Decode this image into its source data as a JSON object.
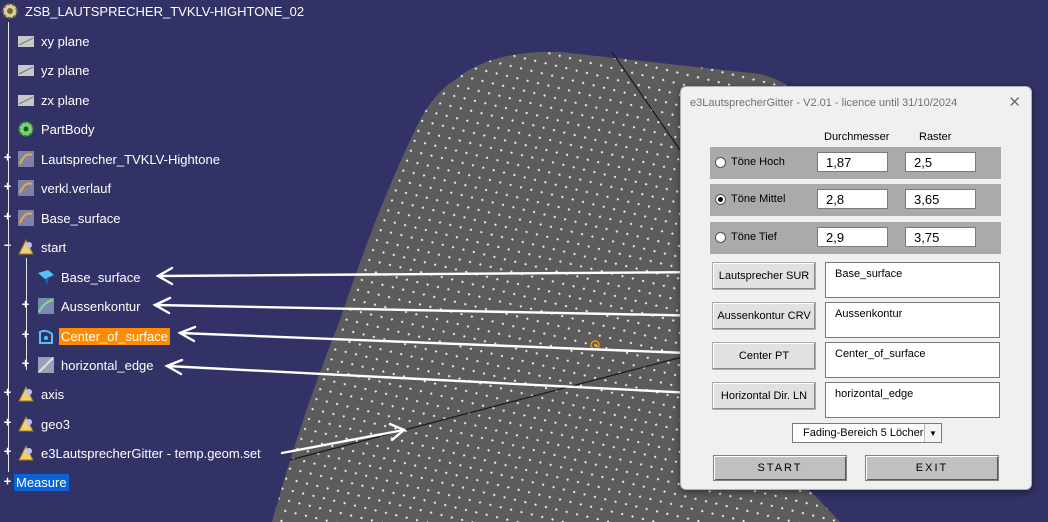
{
  "tree": {
    "root": "ZSB_LAUTSPRECHER_TVKLV-HIGHTONE_02",
    "nodes": [
      {
        "label": "xy plane"
      },
      {
        "label": "yz plane"
      },
      {
        "label": "zx plane"
      },
      {
        "label": "PartBody"
      },
      {
        "label": "Lautsprecher_TVKLV-Hightone"
      },
      {
        "label": "verkl.verlauf"
      },
      {
        "label": "Base_surface"
      },
      {
        "label": "start"
      },
      {
        "label": "Base_surface"
      },
      {
        "label": "Aussenkontur"
      },
      {
        "label": "Center_of_surface"
      },
      {
        "label": "horizontal_edge"
      },
      {
        "label": "axis"
      },
      {
        "label": "geo3"
      },
      {
        "label": "e3LautsprecherGitter - temp.geom.set"
      },
      {
        "label": "Measure"
      }
    ]
  },
  "dialog": {
    "title": "e3LautsprecherGitter - V2.01 - licence until 31/10/2024",
    "close_glyph": "✕",
    "col_durchmesser": "Durchmesser",
    "col_raster": "Raster",
    "rows": [
      {
        "label": "Töne Hoch",
        "durchmesser": "1,87",
        "raster": "2,5",
        "selected": false
      },
      {
        "label": "Töne Mittel",
        "durchmesser": "2,8",
        "raster": "3,65",
        "selected": true
      },
      {
        "label": "Töne Tief",
        "durchmesser": "2,9",
        "raster": "3,75",
        "selected": false
      }
    ],
    "selections": [
      {
        "button": "Lautsprecher SUR",
        "value": "Base_surface"
      },
      {
        "button": "Aussenkontur CRV",
        "value": "Aussenkontur"
      },
      {
        "button": "Center PT",
        "value": "Center_of_surface"
      },
      {
        "button": "Horizontal Dir. LN",
        "value": "horizontal_edge"
      }
    ],
    "fading": {
      "selected": "Fading-Bereich 5 Löcher",
      "arrow": "▼"
    },
    "start_label": "START",
    "exit_label": "EXIT"
  },
  "colors": {
    "background": "#323267",
    "surface": "#5a5a5a",
    "highlight": "#ff8c00",
    "selection": "#0a64d8"
  },
  "icons": {
    "root": "part-gear-icon",
    "plane": "plane-icon",
    "body": "partbody-gear-icon",
    "geoset": "geometrical-set-icon",
    "surface": "surface-icon",
    "curve": "curve-icon",
    "point": "point-icon",
    "line": "line-icon"
  }
}
